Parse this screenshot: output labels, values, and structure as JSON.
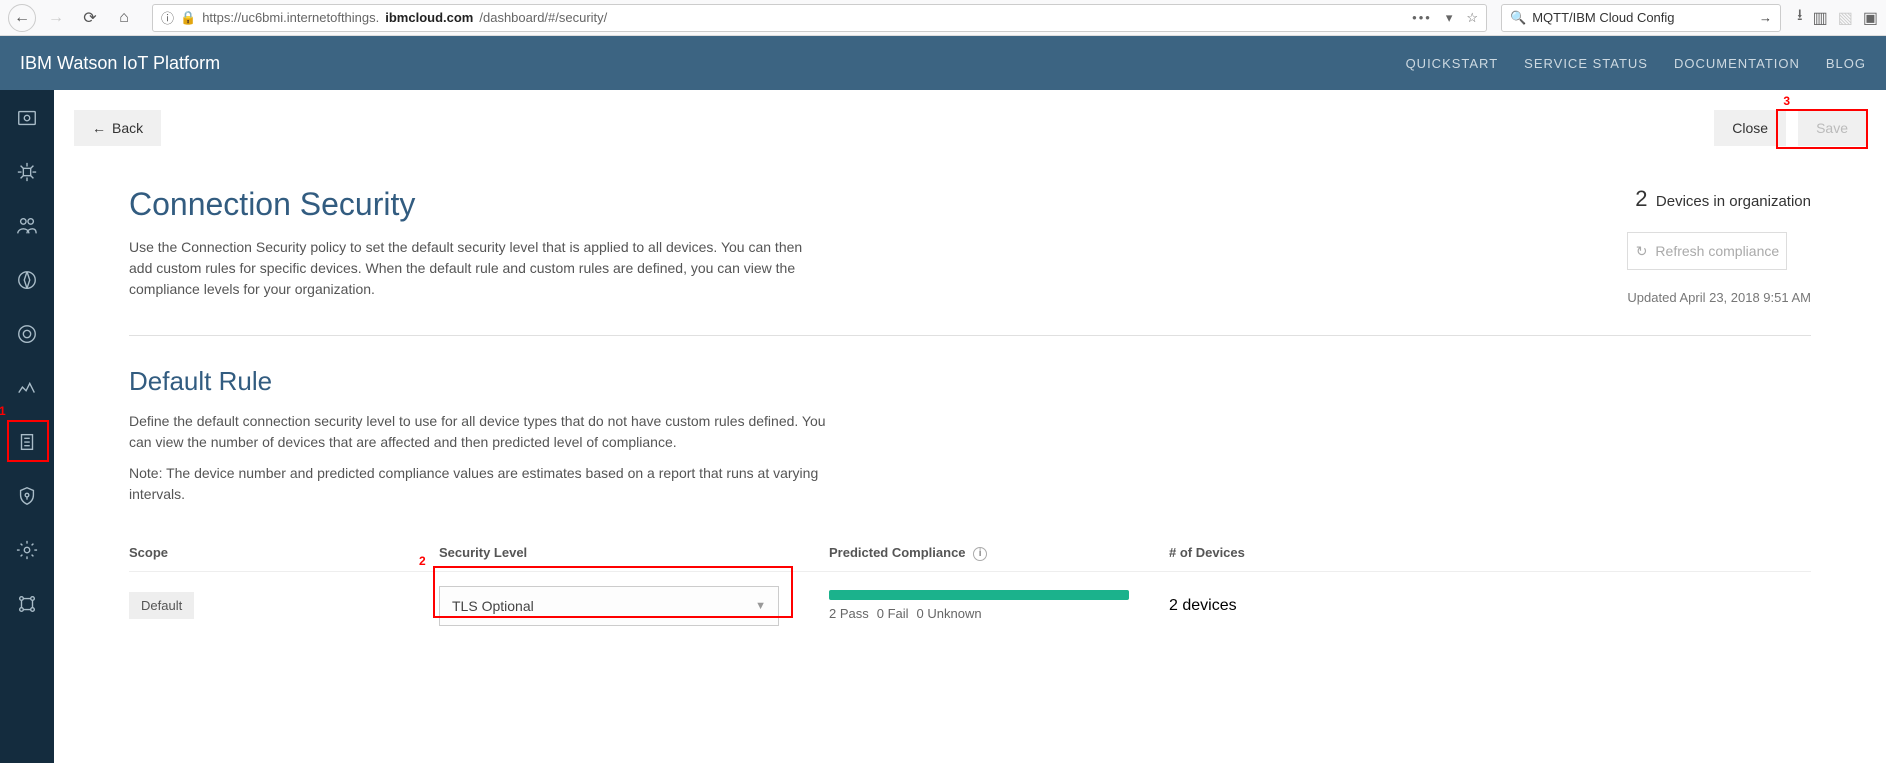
{
  "browser": {
    "url_prefix": "https://uc6bmi.internetofthings.",
    "url_bold": "ibmcloud.com",
    "url_suffix": "/dashboard/#/security/",
    "search_value": "MQTT/IBM Cloud Config"
  },
  "header": {
    "title": "IBM Watson IoT Platform",
    "nav": [
      "QUICKSTART",
      "SERVICE STATUS",
      "DOCUMENTATION",
      "BLOG"
    ]
  },
  "actions": {
    "back": "Back",
    "close": "Close",
    "save": "Save"
  },
  "page": {
    "h1": "Connection Security",
    "desc": "Use the Connection Security policy to set the default security level that is applied to all devices. You can then add custom rules for specific devices. When the default rule and custom rules are defined, you can view the compliance levels for your organization.",
    "org_count": "2",
    "org_label": "Devices in organization",
    "refresh": "Refresh compliance",
    "updated": "Updated April 23, 2018 9:51 AM",
    "h2": "Default Rule",
    "desc2a": "Define the default connection security level to use for all device types that do not have custom rules defined. You can view the number of devices that are affected and then predicted level of compliance.",
    "desc2b": "Note: The device number and predicted compliance values are estimates based on a report that runs at varying intervals.",
    "cols": {
      "scope": "Scope",
      "level": "Security Level",
      "compliance": "Predicted Compliance",
      "devices": "# of Devices"
    },
    "row": {
      "scope": "Default",
      "level": "TLS Optional",
      "pass": "2 Pass",
      "fail": "0 Fail",
      "unknown": "0 Unknown",
      "devices": "2 devices"
    }
  },
  "annotations": {
    "one": "1",
    "two": "2",
    "three": "3"
  }
}
